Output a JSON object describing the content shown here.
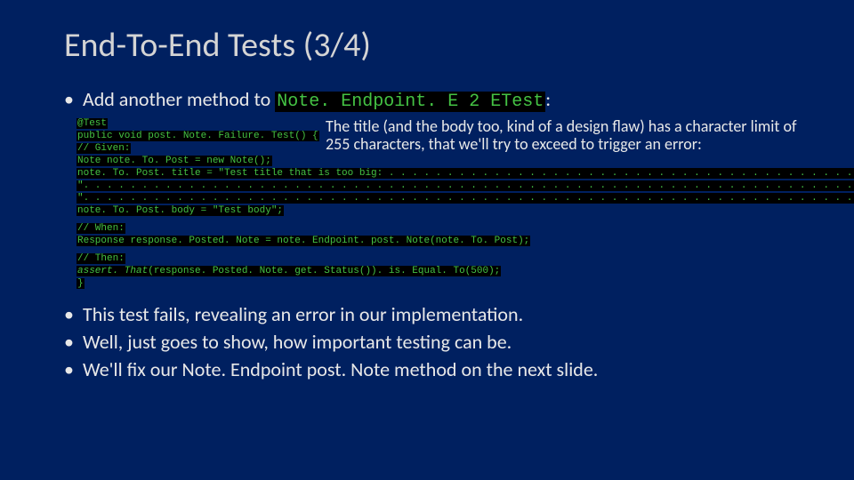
{
  "title": "End-To-End Tests (3/4)",
  "intro": {
    "bullet_dot": "•",
    "prefix": "Add another method to ",
    "classname": "Note. Endpoint. E 2 ETest",
    "suffix": ":"
  },
  "annotation": "The title (and the body too, kind of a design flaw) has a character limit of 255 characters, that we'll try to exceed to trigger an error:",
  "code": {
    "l1": "@Test",
    "l2": "public void post. Note. Failure. Test() {",
    "l3": "   // Given:",
    "l4": "   Note note. To. Post = new Note();",
    "l5": "   note. To. Post. title = \"Test title that is too big: . . . . . . . . . . . . . . . . . . . . . . . . . . . . . . . . . . . . . . . . . . . . . \" +",
    "l6": "           \". . . . . . . . . . . . . . . . . . . . . . . . . . . . . . . . . . . . . . . . . . . . . . . . . . . . . . . . . . . . . . . . . . . . . \" +",
    "l7": "           \". . . . . . . . . . . . . . . . . . . . . . . . . . . . . . . . . . . . . . . . . . . . . . . . . . . . . . . . . . . . . . . . . . . . . \";",
    "l8": "   note. To. Post. body = \"Test body\";",
    "l9": "   // When:",
    "l10": "   Response response. Posted. Note = note. Endpoint. post. Note(note. To. Post);",
    "l11": "   // Then:",
    "l12_a": "   assert. That",
    "l12_b": "(response. Posted. Note. get. Status()). is. Equal. To(500);",
    "l13": "}"
  },
  "bullets": {
    "b1": "This test fails, revealing an error in our implementation.",
    "b2": "Well, just goes to show, how important testing can be.",
    "b3": "We'll fix our Note. Endpoint post. Note method on the next slide."
  }
}
